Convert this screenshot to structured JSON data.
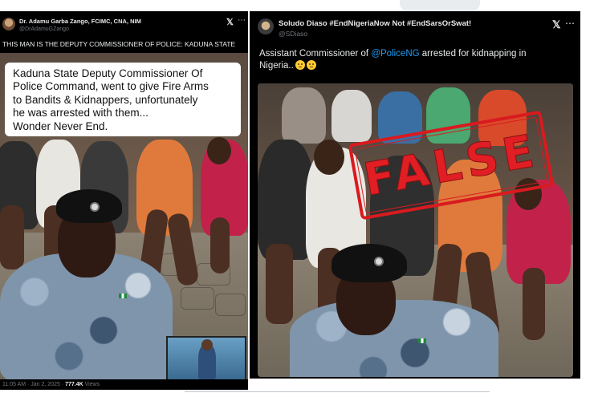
{
  "left_tweet": {
    "author_name": "Dr. Adamu Garba Zango, FCIMC, CNA, NIM",
    "author_handle": "@DrAdamuGZango",
    "x_logo": "x-logo-icon",
    "more_icon": "more-icon",
    "headline": "THIS MAN IS THE DEPUTY COMMISSIONER OF POLICE: KADUNA STATE",
    "caption_lines": [
      "Kaduna State Deputy Commissioner Of",
      "Police Command, went to give Fire Arms",
      "to Bandits & Kidnappers, unfortunately",
      "he was arrested with them...",
      "Wonder Never End."
    ],
    "footer_time": "11:05 AM · Jan 2, 2025 ·",
    "footer_views_count": "777.4K",
    "footer_views_label": "Views"
  },
  "right_tweet": {
    "author_name": "Soludo Diaso #EndNigeriaNow Not #EndSarsOrSwat!",
    "author_handle": "@SDiaso",
    "x_logo": "x-logo-icon",
    "more_icon": "more-icon",
    "text_before": "Assistant Commissioner of ",
    "mention": "@PoliceNG",
    "text_after": " arrested for kidnapping in",
    "text_line2": "Nigeria..",
    "emojis": [
      "grimacing-face-emoji",
      "thinking-face-emoji"
    ],
    "stamp_text": "FALSE"
  },
  "colors": {
    "tweet_bg": "#000000",
    "text": "#e7e9ea",
    "muted": "#71767b",
    "mention": "#1d9bf0",
    "stamp_red": "#e01e24"
  }
}
